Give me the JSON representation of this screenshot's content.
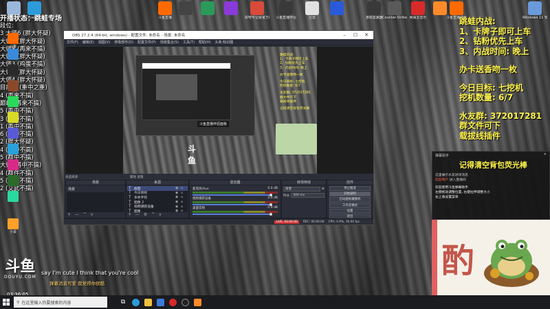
{
  "desktop_icons": [
    {
      "label": "回收站",
      "color": "#9bb7d9"
    },
    {
      "label": "Microsoft Edge",
      "color": "#2d9bd9"
    },
    {
      "label": "斗鱼直播",
      "color": "#ff6a00"
    },
    {
      "label": "",
      "color": "#444"
    },
    {
      "label": "",
      "color": "#2a9a5a"
    },
    {
      "label": "",
      "color": "#8a3ad9"
    },
    {
      "label": "拼吧专业版官方版",
      "color": "#d94a3a"
    },
    {
      "label": "斗鱼直播伴侣",
      "color": "#3a3a3a"
    },
    {
      "label": "迅雷",
      "color": "#e0e0e0"
    },
    {
      "label": "",
      "color": "#2a5ad9"
    },
    {
      "label": "游戏加速器",
      "color": "#3a3a3a"
    },
    {
      "label": "Counter-Strike",
      "color": "#5a5a5a"
    },
    {
      "label": "网易云音乐",
      "color": "#d92a2a"
    },
    {
      "label": "",
      "color": "#ff8a2a"
    },
    {
      "label": "斗鱼直播伴侣",
      "color": "#ff6a00"
    },
    {
      "label": "Windows 11 安装助手",
      "color": "#6a9ad9"
    }
  ],
  "left_overlay": {
    "title": "开播状态：跳蛙专场",
    "rows": [
      "段位:",
      "3 大师6 (胖大怀疑)",
      "大师7 (胖大怀疑)",
      "大师8 (再来不搞)",
      "大师9 (胖大怀疑)",
      "大师3 (鸡蛋不搞)",
      "大师1 (胖大怀疑)",
      "大师4 (胖大怀疑)",
      "目前上 (重中之重)",
      "4 (再来不搞)",
      "巅峰 (再来不搞)",
      "5 (再中不搞)",
      "3 (再中不搞)",
      "1 (再中不搞)",
      "6 (再中不搞)",
      "2 (胖大怀疑)",
      "4 (最中不高)",
      "5 (群中不搞)",
      "大师 (再中不搞)",
      "4 (群件不搞)",
      "5 (再来不搞)",
      "2 (艾武不搞)"
    ]
  },
  "side_icons": [
    {
      "label": "斗鱼",
      "color": "#ff6a00"
    },
    {
      "label": "",
      "color": "#3a8ad9"
    },
    {
      "label": "",
      "color": "#2a2a2a"
    },
    {
      "label": "",
      "color": "#8a4a2a"
    },
    {
      "label": "",
      "color": "#2ad95a"
    },
    {
      "label": "",
      "color": "#d9d92a"
    },
    {
      "label": "",
      "color": "#5a5ad9"
    },
    {
      "label": "",
      "color": "#2aa0d9"
    },
    {
      "label": "",
      "color": "#d92a8a"
    },
    {
      "label": "",
      "color": "#2a6a2a"
    },
    {
      "label": "",
      "color": "#2ad9a0"
    },
    {
      "label": "小说",
      "color": "#ffa02a"
    }
  ],
  "obs": {
    "title": "OBS 27.2.4 (64-bit, windows) - 配置文件: 未命名 - 场景: 未命名",
    "menu": [
      "文件(F)",
      "编辑(E)",
      "视图(V)",
      "停靠部件(D)",
      "配置文件(P)",
      "场景集合(S)",
      "工具(T)",
      "帮助(H)",
      "头条·知识圈"
    ],
    "preview_caption": "斗鱼直播伴侣面板",
    "preview_logo": "斗鱼",
    "preview_side_text": [
      "跳蛙内战:",
      "1、卡牌子即可上车",
      "2、钻粉优先上车",
      "3、内战时间: 晚上",
      "",
      "办卡送香吻一枚",
      "",
      "今日目标: 七挖机",
      "挖机数量: 6/7",
      "",
      "水友群: 372017281",
      "群文件可下",
      "载拔线插件",
      "",
      "记得清空背包荧光棒"
    ],
    "section_left": "未选择源",
    "section_right": "属性   滤镜",
    "docks": {
      "scenes": {
        "title": "场景",
        "items": [
          "场景"
        ],
        "foot": "+ — ^ v"
      },
      "sources": {
        "title": "来源",
        "items": [
          "截图",
          "今日目标",
          "多余字符",
          "图像 2",
          "视频捕获设备",
          "图像"
        ],
        "foot": "+ — ⚙ ^ v"
      },
      "mixer": {
        "title": "混音器",
        "channels": [
          {
            "name": "麦克风/Aux",
            "db": "0.0 dB"
          },
          {
            "name": "视频捕获设备",
            "db": "0.0 dB"
          },
          {
            "name": "桌面音频",
            "db": "-5.9 dB"
          }
        ]
      },
      "transitions": {
        "title": "转场特效",
        "type": "渐变",
        "duration_label": "时长",
        "duration": "300 ms"
      },
      "controls": {
        "title": "控件",
        "buttons": [
          "停止推流",
          "开始录制",
          "启动虚拟摄像机",
          "工作室模式",
          "设置",
          "退出"
        ]
      }
    },
    "status": {
      "live": "LIVE: 00:00:00",
      "rec": "REC: 00:00:00",
      "cpu": "CPU: 0.9%, 30.00 fps"
    }
  },
  "right_overlay": {
    "lines": [
      "跳蛙内战:",
      "1、卡牌子即可上车",
      "2、钻粉优先上车",
      "3、内战时间: 晚上"
    ],
    "card": "办卡送香吻一枚",
    "goal_lines": [
      "今日目标: 七挖机",
      "挖机数量: 6/7"
    ],
    "group_lines": [
      "水友群: 372017281",
      "群文件可下",
      "载拔线插件"
    ]
  },
  "chat": {
    "title": "弹幕助手",
    "banner": "记得清空背包荧光棒",
    "lines": [
      {
        "user": "",
        "text": "这里展示水友进场消息"
      },
      {
        "user": "欢迎用户",
        "text": "进入直播间"
      },
      {
        "user": "",
        "text": "欢迎使用斗鱼弹幕助手"
      },
      {
        "user": "",
        "text": "左键拖动调整位置, 右键拉伸调整大小"
      },
      {
        "user": "",
        "text": "右上角设置菜单"
      }
    ]
  },
  "poster_char": "酌",
  "douyu_logo": {
    "mark": "斗鱼",
    "text": "DOUYU.COM"
  },
  "danmaku_en": "say I'm cute I think that you're cool",
  "danmaku_cn": "弹幕消息可爱 我觉得你很酷",
  "clock_small": "03:36:05",
  "taskbar": {
    "search_placeholder": "在这里输入你要搜索的内容"
  }
}
